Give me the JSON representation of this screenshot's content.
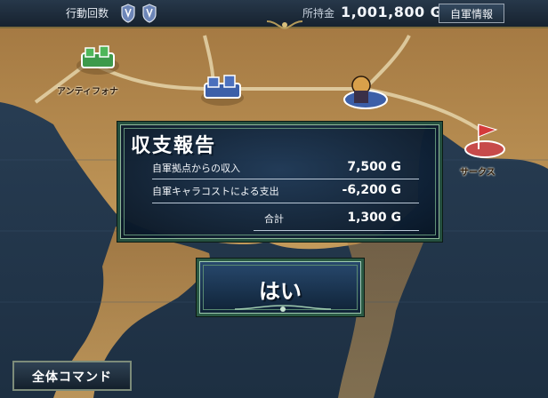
{
  "topbar": {
    "actions_label": "行動回数",
    "money_label": "所持金",
    "money_value": "1,001,800 G",
    "status_button": "自軍情報"
  },
  "map": {
    "towns": [
      {
        "name": "アンティフォナ",
        "marker": "green-castle-icon"
      },
      {
        "name": "サークス",
        "marker": "red-flag-icon"
      }
    ]
  },
  "dialog": {
    "title": "収支報告",
    "rows": [
      {
        "label": "自軍拠点からの収入",
        "value": "7,500 G"
      },
      {
        "label": "自軍キャラコストによる支出",
        "value": "-6,200 G"
      },
      {
        "label": "合計",
        "value": "1,300 G"
      }
    ]
  },
  "yes_button": "はい",
  "all_command_button": "全体コマンド",
  "colors": {
    "dialog_border": "#25503f",
    "dialog_fill": "#0f2538",
    "sea": "#23384d",
    "land": "#b48a4f"
  }
}
